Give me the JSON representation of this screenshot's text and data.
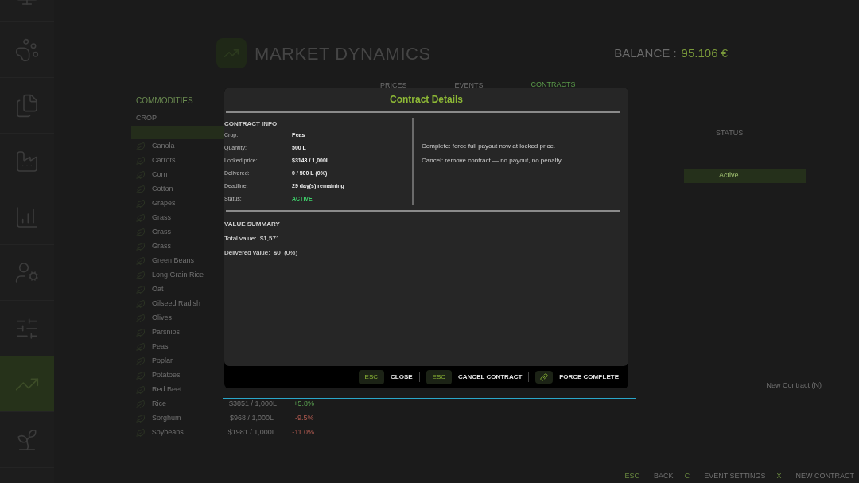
{
  "sidebar": {
    "items": [
      {
        "selected": false
      },
      {
        "selected": false
      },
      {
        "selected": false
      },
      {
        "selected": false
      },
      {
        "selected": false
      },
      {
        "selected": false
      },
      {
        "selected": false
      },
      {
        "selected": true
      },
      {
        "selected": false
      }
    ]
  },
  "header": {
    "title": "MARKET DYNAMICS",
    "balance_label": "BALANCE :",
    "balance_value": "95.106 €"
  },
  "tabs": [
    {
      "label": "PRICES",
      "selected": false
    },
    {
      "label": "EVENTS",
      "selected": false
    },
    {
      "label": "CONTRACTS",
      "selected": true
    }
  ],
  "commodities": {
    "title": "COMMODITIES",
    "column_header": "CROP",
    "rows": [
      {
        "name": "Canola",
        "selected": false
      },
      {
        "name": "Carrots",
        "selected": false
      },
      {
        "name": "Corn",
        "selected": false
      },
      {
        "name": "Cotton",
        "selected": false
      },
      {
        "name": "Grapes",
        "selected": false
      },
      {
        "name": "Grass",
        "selected": false
      },
      {
        "name": "Grass",
        "selected": false
      },
      {
        "name": "Grass",
        "selected": false
      },
      {
        "name": "Green Beans",
        "selected": false
      },
      {
        "name": "Long Grain Rice",
        "selected": false
      },
      {
        "name": "Oat",
        "selected": false
      },
      {
        "name": "Oilseed Radish",
        "selected": false
      },
      {
        "name": "Olives",
        "selected": false
      },
      {
        "name": "Parsnips",
        "selected": false
      },
      {
        "name": "Peas",
        "selected": false
      },
      {
        "name": "Poplar",
        "selected": false
      },
      {
        "name": "Potatoes",
        "selected": false
      },
      {
        "name": "Red Beet",
        "selected": false
      },
      {
        "name": "Rice",
        "selected": false,
        "price": "$3851 / 1,000L",
        "change": "+5.8%"
      },
      {
        "name": "Sorghum",
        "selected": false,
        "price": "$968 / 1,000L",
        "change": "-9.5%"
      },
      {
        "name": "Soybeans",
        "selected": false,
        "price": "$1981 / 1,000L",
        "change": "-11.0%"
      }
    ]
  },
  "contracts": {
    "status_header": "STATUS",
    "rows": [
      {
        "status": "Active",
        "selected": true
      }
    ],
    "new_contract": "New Contract (N)"
  },
  "footer_actions": [
    {
      "key": "ESC",
      "label": "BACK"
    },
    {
      "key": "C",
      "label": "EVENT SETTINGS"
    },
    {
      "key": "X",
      "label": "NEW CONTRACT"
    }
  ],
  "dialog": {
    "title": "Contract Details",
    "contract_info": {
      "heading": "CONTRACT INFO",
      "fields": [
        {
          "label": "Crop:",
          "value": "Peas",
          "kind": "text"
        },
        {
          "label": "Quantity:",
          "value": "500 L",
          "kind": "text"
        },
        {
          "label": "Locked price:",
          "value": "$3143 / 1,000L",
          "kind": "text"
        },
        {
          "label": "Delivered:",
          "value": "0 / 500 L  (0%)",
          "kind": "text"
        },
        {
          "label": "Deadline:",
          "value": "29 day(s) remaining",
          "kind": "text"
        },
        {
          "label": "Status:",
          "value": "ACTIVE",
          "kind": "status"
        }
      ]
    },
    "notes": [
      "Complete: force full payout now at locked price.",
      "Cancel: remove contract — no payout, no penalty."
    ],
    "value_summary": {
      "heading": "VALUE SUMMARY",
      "lines": [
        {
          "label": "Total value:",
          "value": "$1,571"
        },
        {
          "label": "Delivered value:",
          "value": "$0  (0%)"
        }
      ]
    },
    "buttons": [
      {
        "key": "ESC",
        "label": "CLOSE",
        "kind": "key"
      },
      {
        "key": "ESC",
        "label": "CANCEL CONTRACT",
        "kind": "key"
      },
      {
        "label": "FORCE COMPLETE",
        "kind": "icon"
      }
    ]
  }
}
